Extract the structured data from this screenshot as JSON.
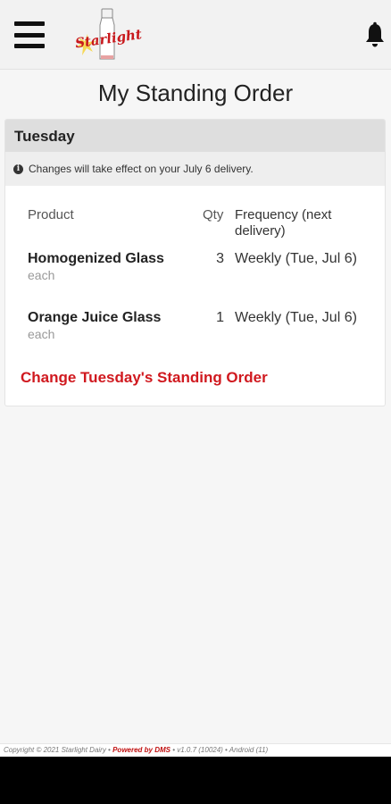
{
  "header": {
    "menu_icon": "hamburger-menu-icon",
    "logo_text": "Starlight",
    "bell_icon": "bell-icon"
  },
  "page": {
    "title": "My Standing Order"
  },
  "order_card": {
    "day": "Tuesday",
    "notice": "Changes will take effect on your July 6 delivery.",
    "columns": {
      "product": "Product",
      "qty": "Qty",
      "frequency": "Frequency (next delivery)"
    },
    "items": [
      {
        "name": "Homogenized Glass",
        "unit": "each",
        "qty": "3",
        "frequency": "Weekly (Tue, Jul 6)"
      },
      {
        "name": "Orange Juice Glass",
        "unit": "each",
        "qty": "1",
        "frequency": "Weekly (Tue, Jul 6)"
      }
    ],
    "change_link": "Change Tuesday's Standing Order"
  },
  "footer": {
    "copyright": "Copyright © 2021 Starlight Dairy • ",
    "powered": "Powered by DMS",
    "version": " • v1.0.7 (10024) • Android (11)"
  },
  "colors": {
    "accent_red": "#d0191f",
    "header_bg": "#f2f2f2",
    "card_header_bg": "#dedede"
  }
}
